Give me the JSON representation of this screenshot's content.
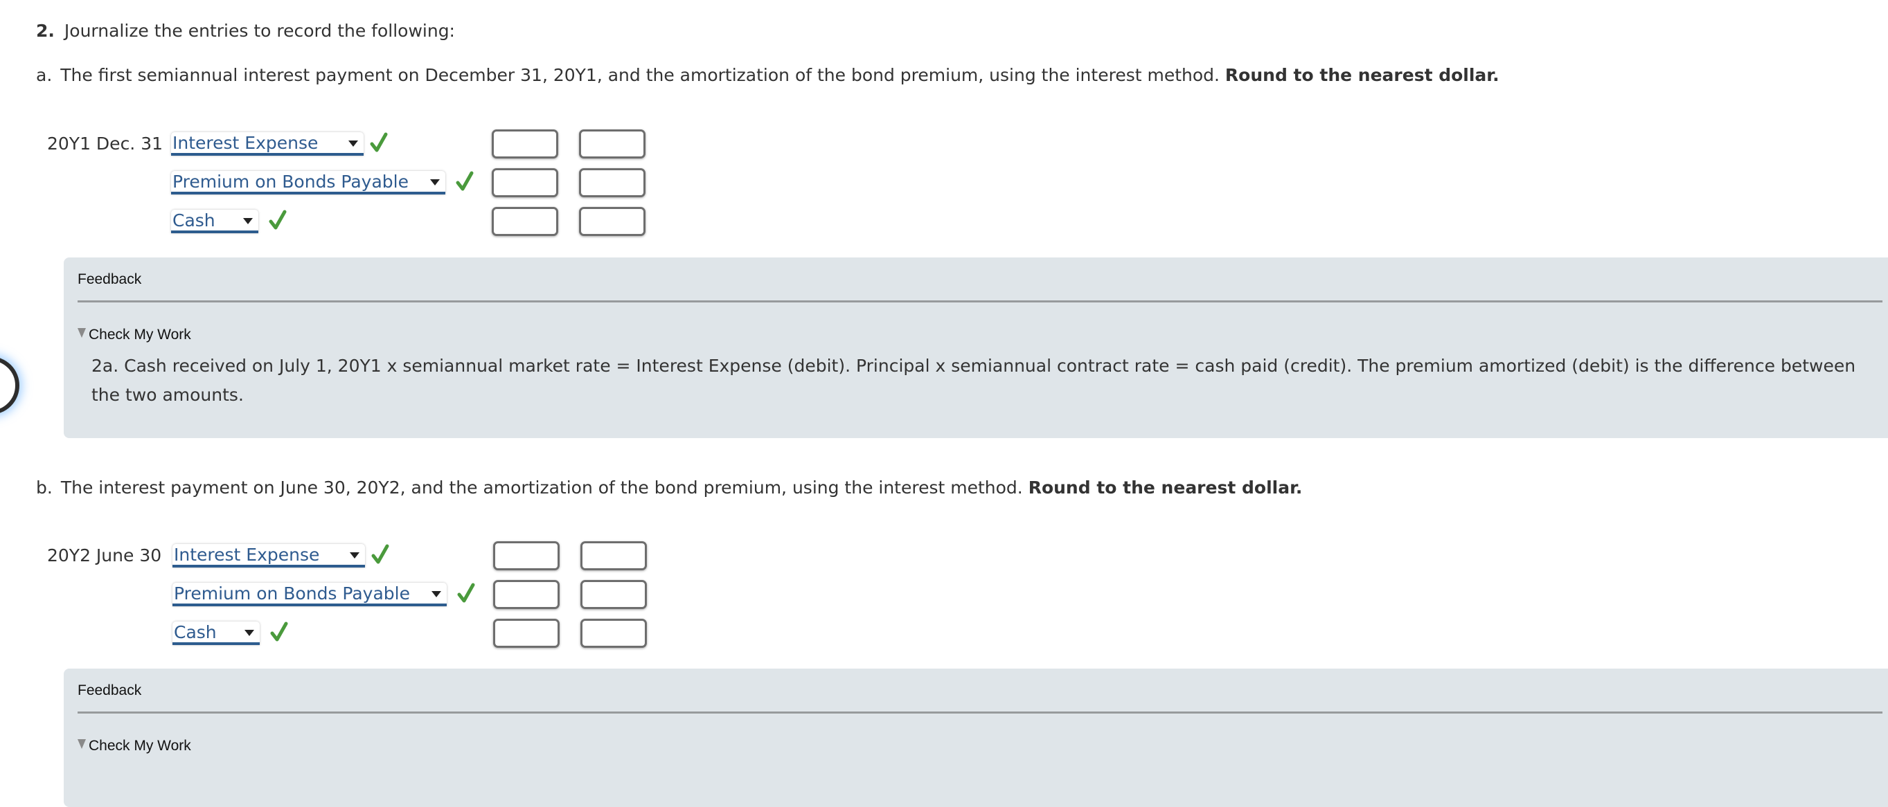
{
  "question": {
    "number": "2.",
    "instruction": "Journalize the entries to record the following:"
  },
  "parts": [
    {
      "letter": "a.",
      "prompt": "The first semiannual interest payment on December 31, 20Y1, and the amortization of the bond premium, using the interest method.",
      "prompt_bold": "Round to the nearest dollar.",
      "date": "20Y1 Dec. 31",
      "rows": [
        {
          "account": "Interest Expense",
          "status": "correct",
          "debit": "",
          "credit": ""
        },
        {
          "account": "Premium on Bonds Payable",
          "status": "correct",
          "debit": "",
          "credit": ""
        },
        {
          "account": "Cash",
          "status": "correct",
          "debit": "",
          "credit": ""
        }
      ],
      "feedback": {
        "title": "Feedback",
        "toggle_label": "Check My Work",
        "body": "2a. Cash received on July 1, 20Y1 x semiannual market rate = Interest Expense (debit). Principal x semiannual contract rate = cash paid (credit). The premium amortized (debit) is the difference between the two amounts."
      }
    },
    {
      "letter": "b.",
      "prompt": "The interest payment on June 30, 20Y2, and the amortization of the bond premium, using the interest method.",
      "prompt_bold": "Round to the nearest dollar.",
      "date": "20Y2 June 30",
      "rows": [
        {
          "account": "Interest Expense",
          "status": "correct",
          "debit": "",
          "credit": ""
        },
        {
          "account": "Premium on Bonds Payable",
          "status": "correct",
          "debit": "",
          "credit": ""
        },
        {
          "account": "Cash",
          "status": "correct",
          "debit": "",
          "credit": ""
        }
      ],
      "feedback": {
        "title": "Feedback",
        "toggle_label": "Check My Work"
      }
    }
  ],
  "icons": {
    "check": "check-icon",
    "dropdown": "caret-down-icon",
    "disclosure": "triangle-down-icon"
  },
  "colors": {
    "text": "#333333",
    "account_link": "#2f5b8f",
    "underline": "#2d5c8e",
    "check_green": "#4a9a3c",
    "feedback_bg": "#dfe5e9",
    "glow": "#5aaaff"
  }
}
